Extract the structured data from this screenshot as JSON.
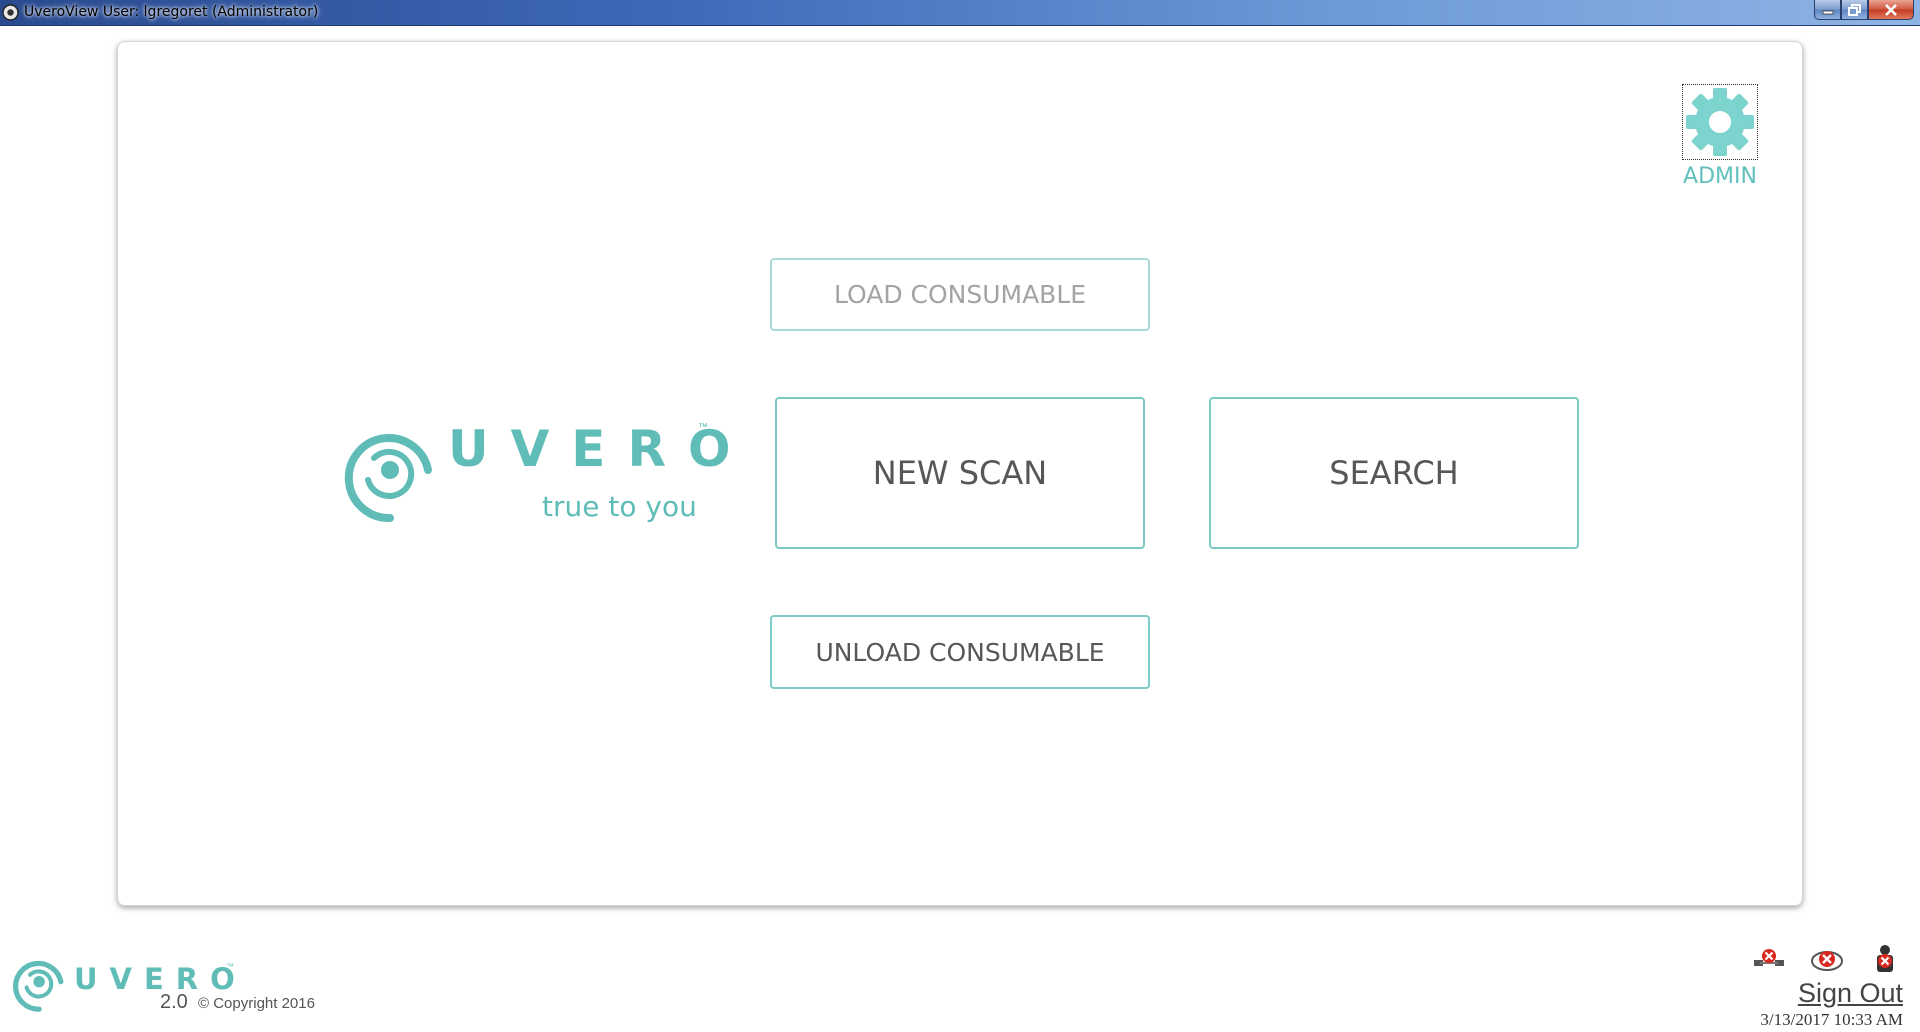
{
  "window": {
    "title": "UveroView User: lgregoret (Administrator)"
  },
  "admin": {
    "label": "ADMIN",
    "icon": "gear-icon"
  },
  "actions": {
    "load_consumable": "LOAD CONSUMABLE",
    "new_scan": "NEW SCAN",
    "search": "SEARCH",
    "unload_consumable": "UNLOAD CONSUMABLE"
  },
  "logo": {
    "wordmark": "UVERO",
    "trademark": "™",
    "tagline": "true to you"
  },
  "footer": {
    "wordmark": "UVERO",
    "trademark": "™",
    "version": "2.0",
    "copyright": "© Copyright 2016",
    "sign_out": "Sign Out",
    "datetime": "3/13/2017 10:33 AM",
    "status_icons": [
      "network-disconnected-icon",
      "cloud-disconnected-icon",
      "device-disconnected-icon"
    ]
  },
  "colors": {
    "brand": "#5fbcb6",
    "button_border": "#7ccac5",
    "disabled_text": "#a3a3a3",
    "error": "#d9281f"
  }
}
